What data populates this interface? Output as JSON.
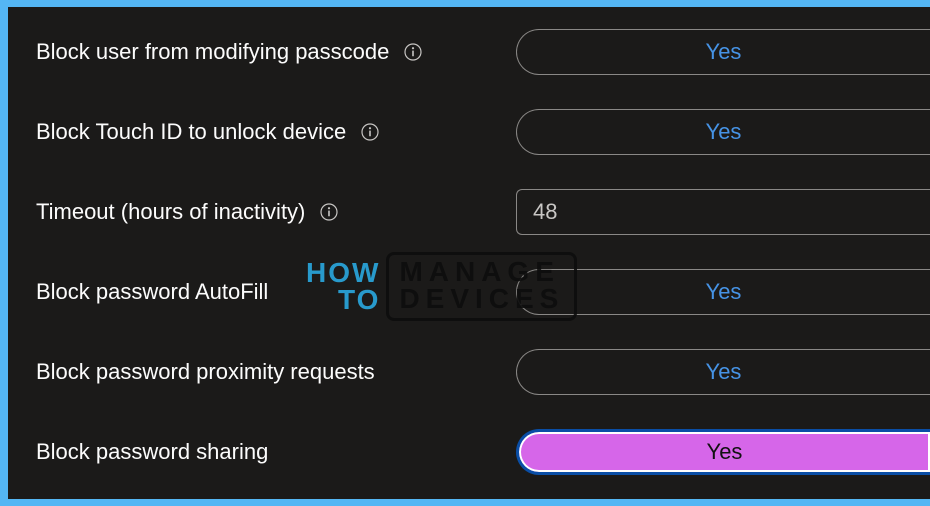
{
  "settings": [
    {
      "label": "Block user from modifying passcode",
      "type": "pill",
      "value": "Yes",
      "selected": false,
      "name": "block-modify-passcode"
    },
    {
      "label": "Block Touch ID to unlock device",
      "type": "pill",
      "value": "Yes",
      "selected": false,
      "name": "block-touch-id"
    },
    {
      "label": "Timeout (hours of inactivity)",
      "type": "text",
      "value": "48",
      "selected": false,
      "name": "timeout-hours"
    },
    {
      "label": "Block password AutoFill",
      "type": "pill",
      "value": "Yes",
      "selected": false,
      "name": "block-autofill"
    },
    {
      "label": "Block password proximity requests",
      "type": "pill",
      "value": "Yes",
      "selected": false,
      "name": "block-proximity"
    },
    {
      "label": "Block password sharing",
      "type": "pill",
      "value": "Yes",
      "selected": true,
      "name": "block-sharing"
    }
  ],
  "watermark": {
    "left_top": "HOW",
    "left_bottom": "TO",
    "right_top": "MANAGE",
    "right_bottom": "DEVICES"
  }
}
